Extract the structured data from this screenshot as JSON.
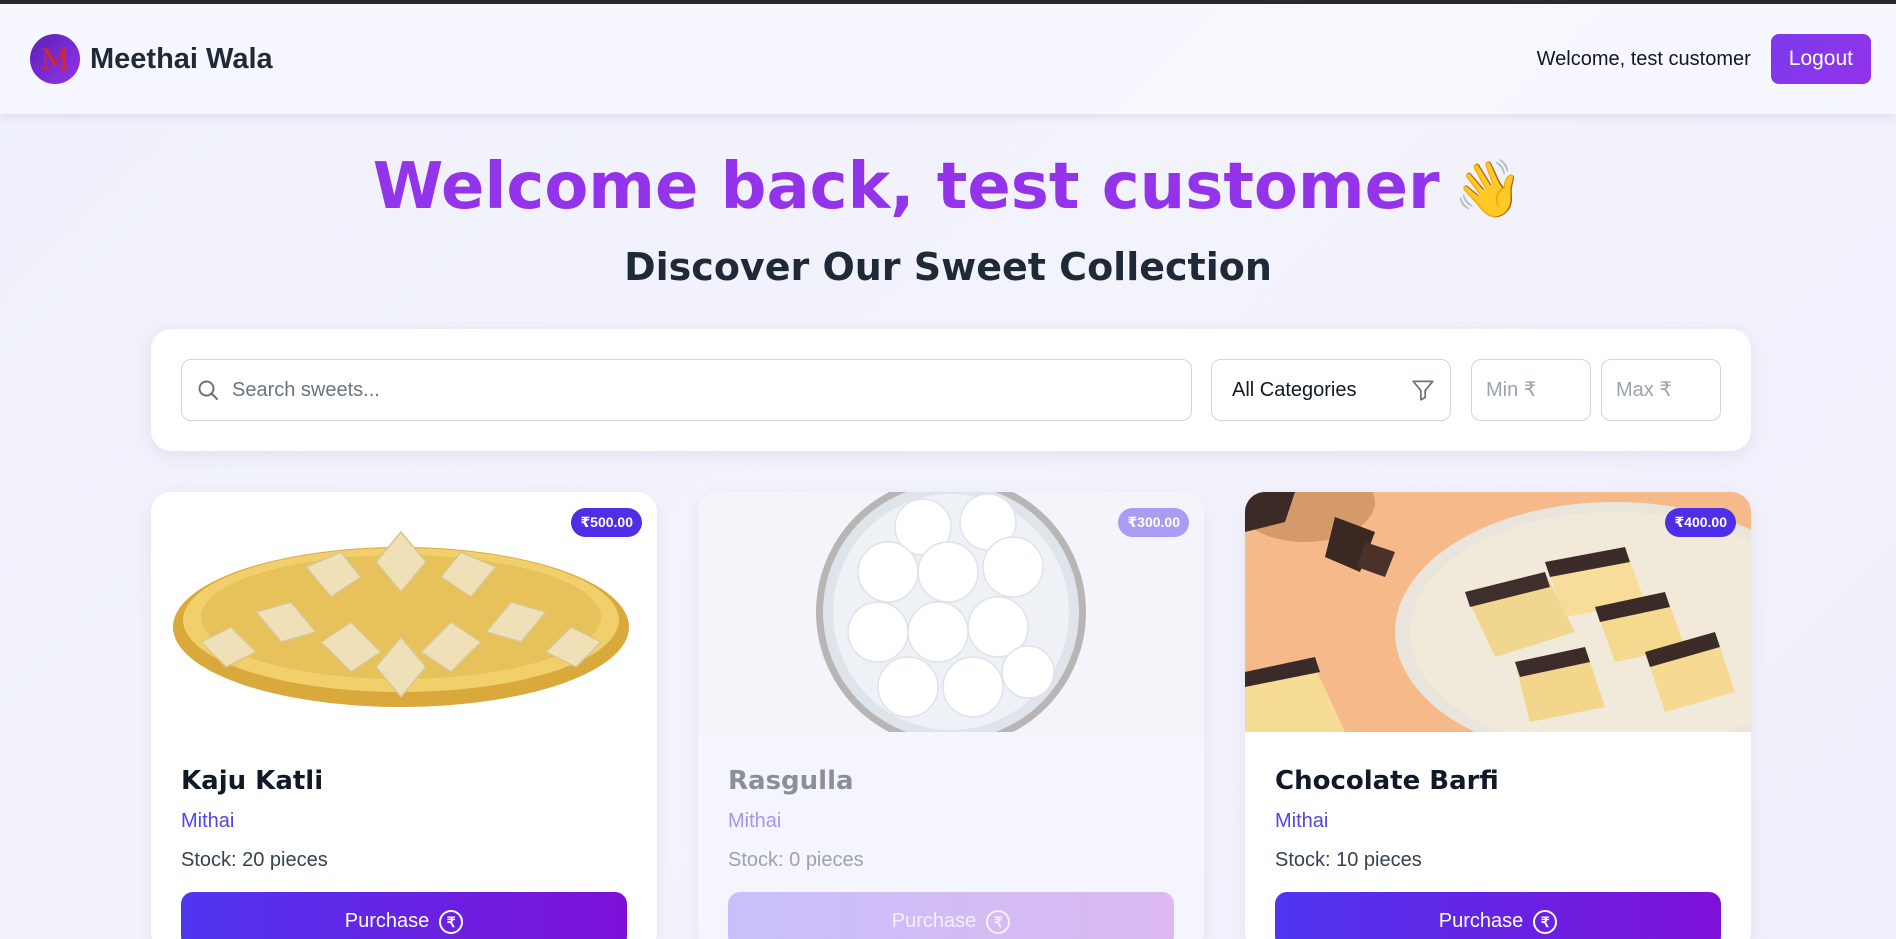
{
  "header": {
    "logo_letter": "M",
    "brand": "Meethai Wala",
    "welcome": "Welcome, test customer",
    "logout_label": "Logout"
  },
  "hero": {
    "title": "Welcome back, test customer",
    "wave_icon": "waving-hand-icon",
    "subtitle": "Discover Our Sweet Collection"
  },
  "filters": {
    "search_placeholder": "Search sweets...",
    "category_selected": "All Categories",
    "min_placeholder": "Min ₹",
    "max_placeholder": "Max ₹"
  },
  "products": [
    {
      "name": "Kaju Katli",
      "category": "Mithai",
      "stock": "Stock: 20 pieces",
      "price": "₹500.00",
      "purchase_label": "Purchase",
      "available": true
    },
    {
      "name": "Rasgulla",
      "category": "Mithai",
      "stock": "Stock: 0 pieces",
      "price": "₹300.00",
      "purchase_label": "Purchase",
      "available": false
    },
    {
      "name": "Chocolate Barfi",
      "category": "Mithai",
      "stock": "Stock: 10 pieces",
      "price": "₹400.00",
      "purchase_label": "Purchase",
      "available": true
    }
  ],
  "colors": {
    "accent": "#7c3aed",
    "title": "#9333ea",
    "badge": "#4f2ee8",
    "category_text": "#4f46e5"
  }
}
